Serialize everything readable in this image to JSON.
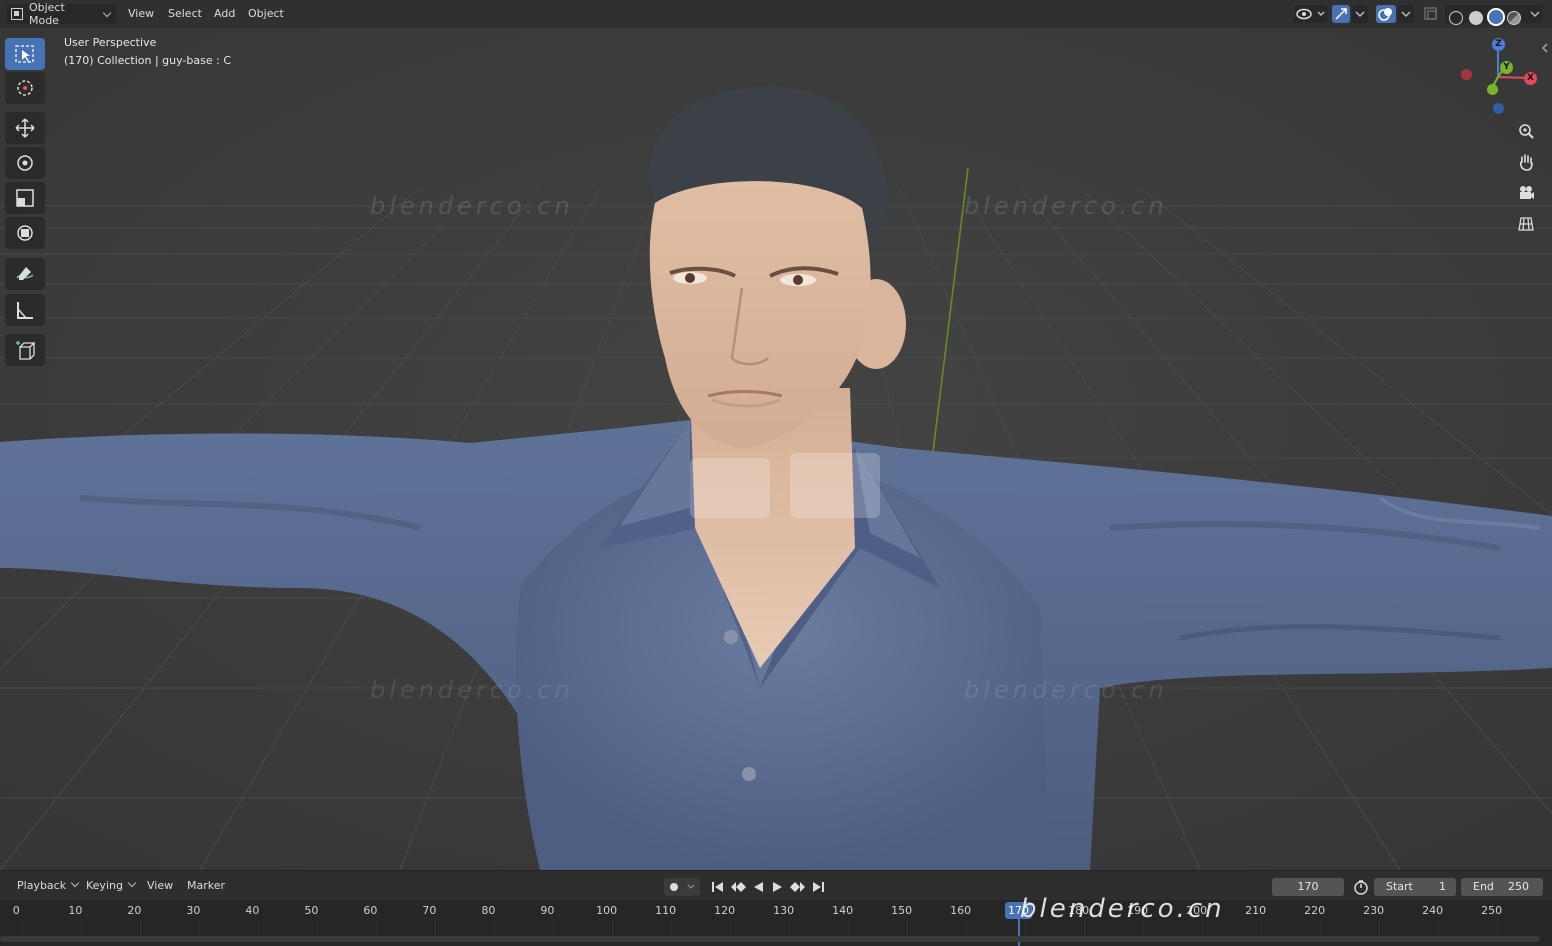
{
  "header": {
    "mode": "Object Mode",
    "menus": [
      "View",
      "Select",
      "Add",
      "Object"
    ]
  },
  "viewport": {
    "view_name": "User Perspective",
    "collection_info": "(170) Collection | guy-base : C",
    "watermark": "blenderco.cn",
    "gizmo": {
      "z": "Z",
      "y": "Y",
      "x": "X"
    },
    "tools": [
      "select-box",
      "cursor",
      "move",
      "rotate",
      "scale",
      "transform",
      "annotate",
      "measure",
      "add-cube"
    ],
    "nav_tools": [
      "zoom",
      "pan",
      "camera",
      "perspective-toggle"
    ]
  },
  "timeline": {
    "menus": [
      "Playback",
      "Keying",
      "View",
      "Marker"
    ],
    "current_frame": "170",
    "start_label": "Start",
    "start_value": "1",
    "end_label": "End",
    "end_value": "250",
    "ticks": [
      "0",
      "10",
      "20",
      "30",
      "40",
      "50",
      "60",
      "70",
      "80",
      "90",
      "100",
      "110",
      "120",
      "130",
      "140",
      "150",
      "160",
      "170",
      "180",
      "190",
      "200",
      "210",
      "220",
      "230",
      "240",
      "250"
    ],
    "watermark": "blenderco.cn"
  },
  "colors": {
    "accent": "#4772b3",
    "shirt": "#5b6d93",
    "skin": "#d9b69d",
    "hair": "#3b4147",
    "background": "#3d3d3d"
  }
}
